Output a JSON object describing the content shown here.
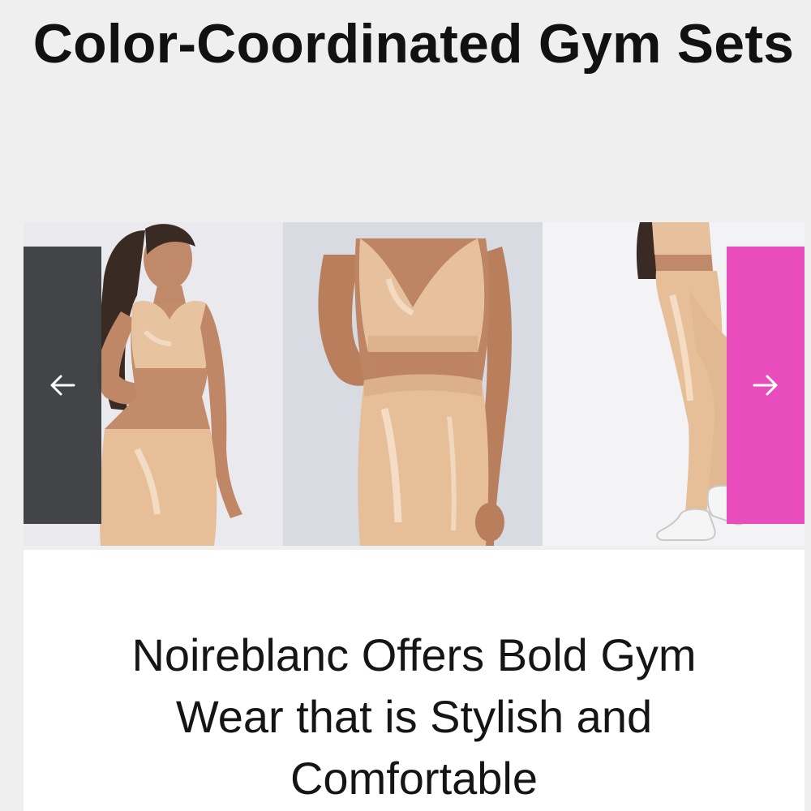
{
  "page": {
    "title": "Color-Coordinated Gym Sets"
  },
  "carousel": {
    "prev_icon": "arrow-left-icon",
    "next_icon": "arrow-right-icon",
    "colors": {
      "prev_button": "#3a3c3f",
      "next_button": "#e94dbd",
      "garment": "#e8c3a0"
    }
  },
  "card": {
    "heading": "Noireblanc Offers Bold Gym Wear that is Stylish and Comfortable"
  }
}
